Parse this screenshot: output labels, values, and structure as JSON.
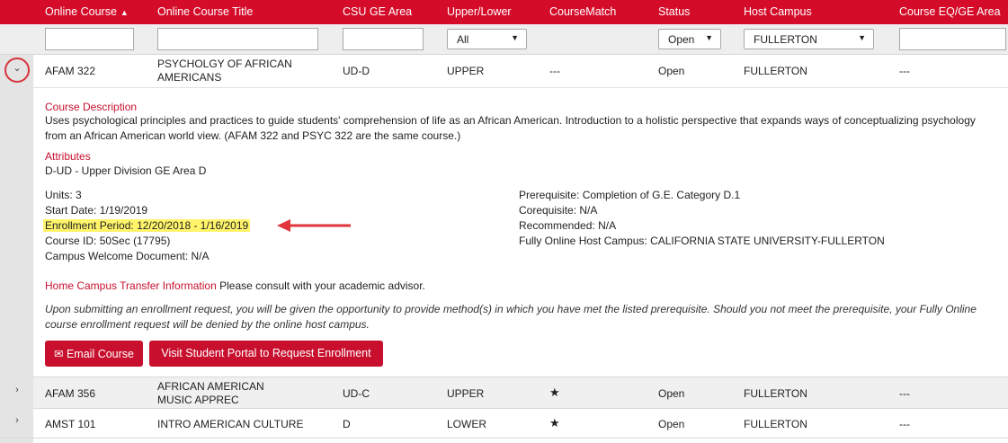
{
  "header": {
    "columns": [
      {
        "label": "Online Course",
        "sorted": true
      },
      {
        "label": "Online Course Title"
      },
      {
        "label": "CSU GE Area"
      },
      {
        "label": "Upper/Lower"
      },
      {
        "label": "CourseMatch"
      },
      {
        "label": "Status"
      },
      {
        "label": "Host Campus"
      },
      {
        "label": "Course EQ/GE Area"
      }
    ],
    "sort_icon": "sort-up-triangle-icon"
  },
  "filters": {
    "upper_lower": "All",
    "status": "Open",
    "host_campus": "FULLERTON"
  },
  "rows": [
    {
      "course": "AFAM 322",
      "title": "PSYCHOLGY OF AFRICAN AMERICANS",
      "ge": "UD-D",
      "level": "UPPER",
      "match": "---",
      "status": "Open",
      "campus": "FULLERTON",
      "eq": "---",
      "expanded": true
    },
    {
      "course": "AFAM 356",
      "title": "AFRICAN AMERICAN MUSIC APPREC",
      "ge": "UD-C",
      "level": "UPPER",
      "match": "★",
      "status": "Open",
      "campus": "FULLERTON",
      "eq": "---",
      "expanded": false
    },
    {
      "course": "AMST 101",
      "title": "INTRO AMERICAN CULTURE",
      "ge": "D",
      "level": "LOWER",
      "match": "★",
      "status": "Open",
      "campus": "FULLERTON",
      "eq": "---",
      "expanded": false
    }
  ],
  "details": {
    "desc_label": "Course Description",
    "desc_text": "Uses psychological principles and practices to guide students' comprehension of life as an African American. Introduction to a holistic perspective that expands ways of conceptualizing psychology from an African American world view. (AFAM 322 and PSYC 322 are the same course.)",
    "attr_label": "Attributes",
    "attr_text": "D-UD - Upper Division GE Area D",
    "units_label": "Units:",
    "units_value": "3",
    "start_label": "Start Date:",
    "start_value": "1/19/2019",
    "enroll_label": "Enrollment Period:",
    "enroll_value": "12/20/2018 - 1/16/2019",
    "courseid_label": "Course ID:",
    "courseid_value": "50Sec (17795)",
    "welcome_label": "Campus Welcome Document:",
    "welcome_value": "N/A",
    "prereq_label": "Prerequisite:",
    "prereq_value": "Completion of G.E. Category D.1",
    "coreq_label": "Corequisite:",
    "coreq_value": "N/A",
    "recommended_label": "Recommended:",
    "recommended_value": "N/A",
    "host_label": "Fully Online Host Campus:",
    "host_value": "CALIFORNIA STATE UNIVERSITY-FULLERTON",
    "transfer_label": "Home Campus Transfer Information",
    "transfer_text": "Please consult with your academic advisor.",
    "notice": "Upon submitting an enrollment request, you will be given the opportunity to provide method(s) in which you have met the listed prerequisite. Should you not meet the prerequisite, your Fully Online course enrollment request will be denied by the online host campus.",
    "email_button": "Email Course",
    "portal_button": "Visit Student Portal to Request Enrollment"
  },
  "colors": {
    "header": "#d40c2a",
    "accent": "#c8102e",
    "highlight": "#fff46a"
  }
}
